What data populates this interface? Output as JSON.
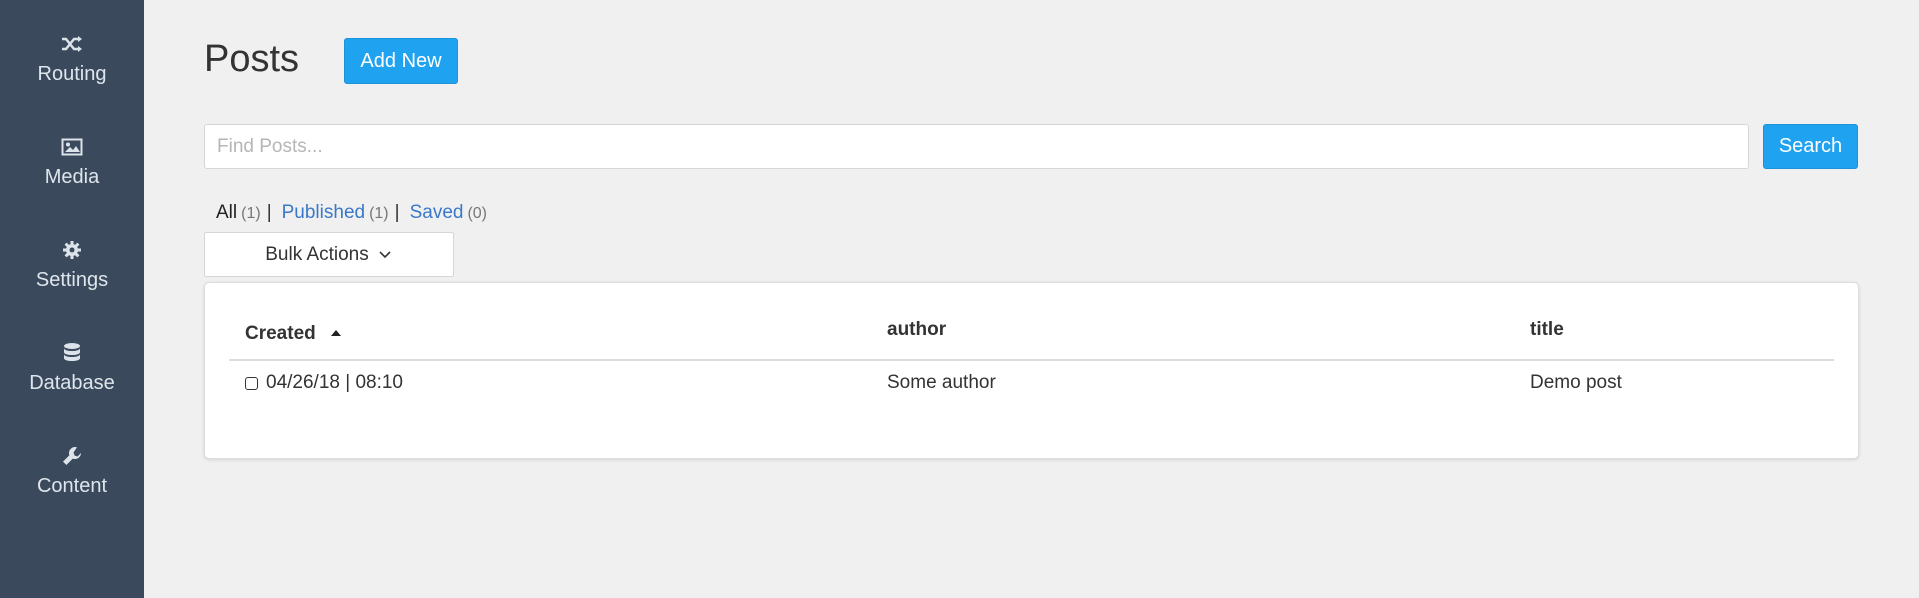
{
  "sidebar": {
    "items": [
      {
        "label": "Routing",
        "icon": "shuffle-icon"
      },
      {
        "label": "Media",
        "icon": "image-icon"
      },
      {
        "label": "Settings",
        "icon": "gear-icon"
      },
      {
        "label": "Database",
        "icon": "database-icon"
      },
      {
        "label": "Content",
        "icon": "wrench-icon"
      }
    ]
  },
  "header": {
    "title": "Posts",
    "add_new_label": "Add New"
  },
  "search": {
    "placeholder": "Find Posts...",
    "value": "",
    "button_label": "Search"
  },
  "filters": {
    "all_label": "All",
    "all_count": "(1)",
    "published_label": "Published",
    "published_count": "(1)",
    "saved_label": "Saved",
    "saved_count": "(0)",
    "separator": "|"
  },
  "bulk_actions": {
    "label": "Bulk Actions"
  },
  "table": {
    "columns": [
      "Created",
      "author",
      "title"
    ],
    "sort_column": "Created",
    "sort_direction": "ascending",
    "rows": [
      {
        "created": "04/26/18 | 08:10",
        "author": "Some author",
        "title": "Demo post"
      }
    ]
  },
  "colors": {
    "sidebar_bg": "#3a4a5c",
    "accent": "#1fa2f0",
    "link": "#3a78c9",
    "page_bg": "#f0f0f0"
  }
}
